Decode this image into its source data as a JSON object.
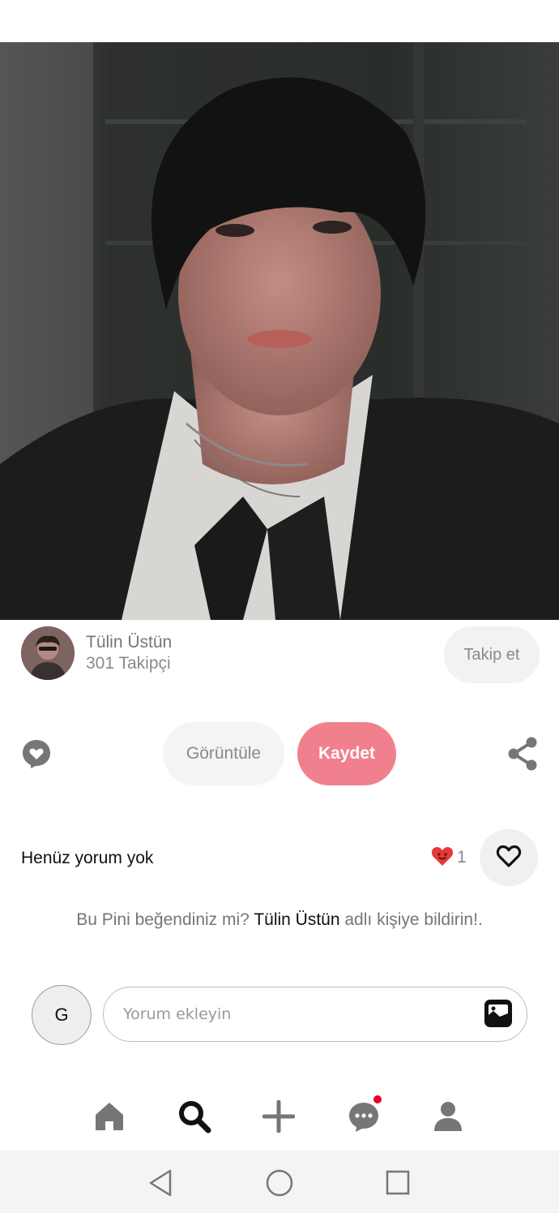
{
  "creator": {
    "name": "Tülin Üstün",
    "followers": "301 Takipçi",
    "follow_label": "Takip et"
  },
  "actions": {
    "view_label": "Görüntüle",
    "save_label": "Kaydet"
  },
  "comments": {
    "title": "Henüz yorum yok",
    "like_count": "1",
    "prompt_before": "Bu Pini beğendiniz mi?",
    "prompt_name": "Tülin Üstün",
    "prompt_after": "adlı kişiye bildirin!.",
    "user_initial": "G",
    "input_placeholder": "Yorum ekleyin"
  },
  "nav": {
    "items": [
      "home-icon",
      "search-icon",
      "add-icon",
      "messages-icon",
      "profile-icon"
    ],
    "active": "search-icon",
    "notification_color": "#e60023"
  },
  "colors": {
    "save_button": "#f1808f",
    "like_heart": "#e53935"
  }
}
